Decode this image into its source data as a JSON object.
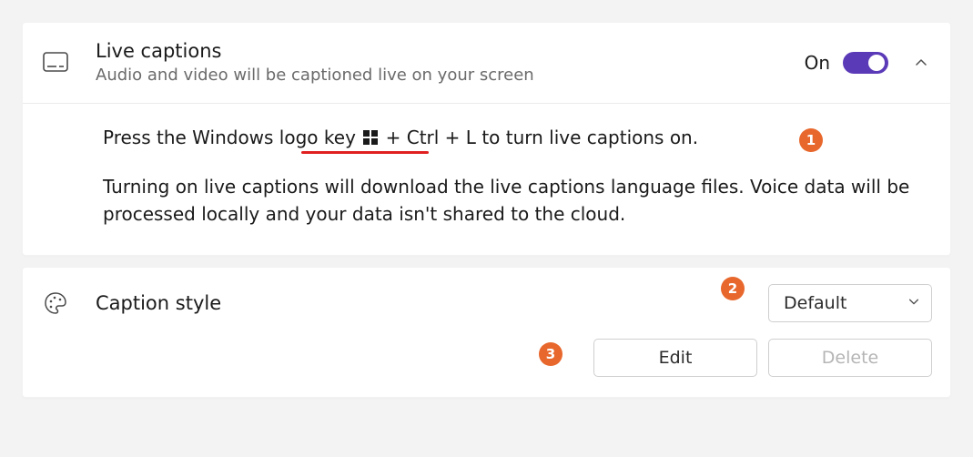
{
  "live_captions": {
    "title": "Live captions",
    "subtitle": "Audio and video will be captioned live on your screen",
    "state_label": "On",
    "help_line_prefix": "Press the Windows logo key ",
    "help_line_shortcut": " + Ctrl + L",
    "help_line_suffix": " to turn live captions on.",
    "note": "Turning on live captions will download the live captions language files. Voice data will be processed locally and your data isn't shared to the cloud."
  },
  "caption_style": {
    "label": "Caption style",
    "selected": "Default",
    "edit_label": "Edit",
    "delete_label": "Delete"
  },
  "annotations": {
    "one": "1",
    "two": "2",
    "three": "3"
  }
}
